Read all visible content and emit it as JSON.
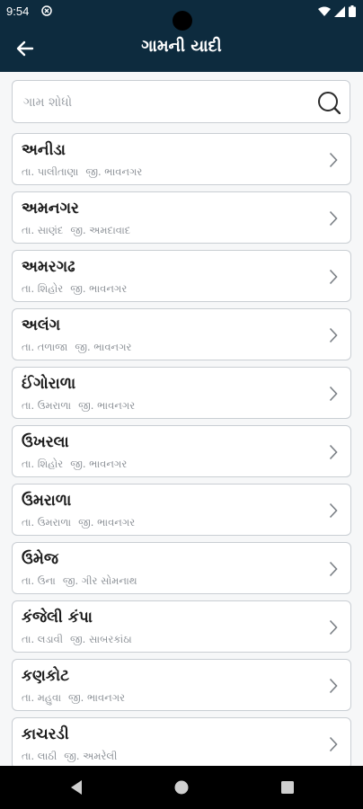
{
  "status_bar": {
    "time": "9:54"
  },
  "header": {
    "title": "ગામની યાદી"
  },
  "search": {
    "placeholder": "ગામ શોધો"
  },
  "villages": [
    {
      "name": "અનીડા",
      "taluka": "તા. પાલીતાણા",
      "district": "જી. ભાવનગર"
    },
    {
      "name": "અમનગર",
      "taluka": "તા. સાણંદ",
      "district": "જી. અમદાવાદ"
    },
    {
      "name": "અમરગઢ",
      "taluka": "તા. શિહોર",
      "district": "જી. ભાવનગર"
    },
    {
      "name": "અલંગ",
      "taluka": "તા. તળાજા",
      "district": "જી. ભાવનગર"
    },
    {
      "name": "ઈંગોરાળા",
      "taluka": "તા. ઉમરાળા",
      "district": "જી. ભાવનગર"
    },
    {
      "name": "ઉખરલા",
      "taluka": "તા. શિહોર",
      "district": "જી. ભાવનગર"
    },
    {
      "name": "ઉમરાળા",
      "taluka": "તા. ઉમરાળા",
      "district": "જી. ભાવનગર"
    },
    {
      "name": "ઉમેજ",
      "taluka": "તા. ઉના",
      "district": "જી. ગીર સોમનાથ"
    },
    {
      "name": "કંજેલી કંપા",
      "taluka": "તા. લડાવી",
      "district": "જી. સાબરકાંઠા"
    },
    {
      "name": "કણકોટ",
      "taluka": "તા. મહુવા",
      "district": "જી. ભાવનગર"
    },
    {
      "name": "કાચરડી",
      "taluka": "તા. લાઠી",
      "district": "જી. અમરેલી"
    }
  ],
  "colors": {
    "header_bg": "#0d2b3e",
    "page_bg": "#f6f7f8",
    "card_border": "#c9ced3"
  },
  "icons": {
    "back": "arrow-left-icon",
    "search": "search-icon",
    "chevron": "chevron-right-icon",
    "nav_back": "triangle-back-icon",
    "nav_home": "circle-home-icon",
    "nav_recents": "square-recents-icon"
  }
}
